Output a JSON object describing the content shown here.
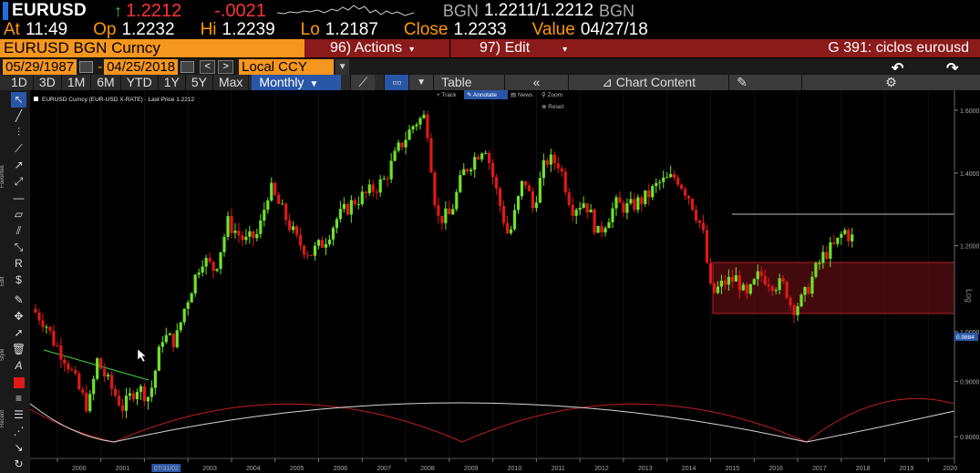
{
  "ticker": {
    "symbol": "EURUSD",
    "arrow": "↑",
    "last": "1.2212",
    "change": "-.0021",
    "source_label": "BGN",
    "bid_ask": "1.2211/1.2212",
    "source_label2": "BGN"
  },
  "stats": {
    "at_label": "At",
    "at": "11:49",
    "op_label": "Op",
    "op": "1.2232",
    "hi_label": "Hi",
    "hi": "1.2239",
    "lo_label": "Lo",
    "lo": "1.2187",
    "close_label": "Close",
    "close": "1.2233",
    "value_label": "Value",
    "value": "04/27/18"
  },
  "titlebar": {
    "security": "EURUSD BGN Curncy",
    "actions": "96) Actions",
    "edit": "97) Edit",
    "chart_name": "G 391: ciclos eurousd"
  },
  "dates": {
    "start": "05/29/1987",
    "end": "04/25/2018",
    "currency": "Local CCY"
  },
  "periods": [
    "1D",
    "3D",
    "1M",
    "6M",
    "YTD",
    "1Y",
    "5Y",
    "Max"
  ],
  "frequency": "Monthly",
  "toolbar": {
    "table": "Table",
    "chart_content": "Chart Content"
  },
  "subtools": {
    "track": "Track",
    "annotate": "Annotate",
    "news": "News",
    "zoom": "Zoom",
    "reset": "Reset"
  },
  "side_labels": {
    "favorites": "Favorites",
    "edit": "Edit",
    "style": "Style",
    "more": "Recent"
  },
  "colors": {
    "up": "#6fe22a",
    "down": "#e01818",
    "accent": "#f5961e",
    "red_bar": "#8b1a1a",
    "blue": "#2a56a8"
  },
  "chart_data": {
    "type": "candlestick",
    "legend": "EURUSD Curncy (EUR-USD X-RATE) · Last Price 1.2212",
    "y_scale": "log",
    "ylim": [
      0.77,
      1.65
    ],
    "y_ticks": [
      "1.6000",
      "1.4000",
      "1.2000",
      "1.0000",
      "0.9000",
      "0.8000"
    ],
    "last_marker": "0.9884",
    "axis_label": "Log",
    "x_ticks": [
      "2000",
      "2001",
      "07/31/02",
      "2003",
      "2004",
      "2005",
      "2006",
      "2007",
      "2008",
      "2009",
      "2010",
      "2011",
      "2012",
      "2013",
      "2014",
      "2015",
      "2016",
      "2017",
      "2018",
      "2019",
      "2020"
    ],
    "x_start": 1999.5,
    "x_end": 2020.6,
    "series": [
      {
        "x": 1999.5,
        "y": 1.05
      },
      {
        "x": 1999.8,
        "y": 1.02
      },
      {
        "x": 2000.0,
        "y": 0.98
      },
      {
        "x": 2000.3,
        "y": 0.94
      },
      {
        "x": 2000.6,
        "y": 0.88
      },
      {
        "x": 2000.8,
        "y": 0.85
      },
      {
        "x": 2001.0,
        "y": 0.94
      },
      {
        "x": 2001.3,
        "y": 0.89
      },
      {
        "x": 2001.6,
        "y": 0.85
      },
      {
        "x": 2001.9,
        "y": 0.89
      },
      {
        "x": 2002.2,
        "y": 0.87
      },
      {
        "x": 2002.5,
        "y": 0.99
      },
      {
        "x": 2002.8,
        "y": 0.98
      },
      {
        "x": 2003.0,
        "y": 1.05
      },
      {
        "x": 2003.4,
        "y": 1.17
      },
      {
        "x": 2003.7,
        "y": 1.14
      },
      {
        "x": 2004.0,
        "y": 1.26
      },
      {
        "x": 2004.4,
        "y": 1.21
      },
      {
        "x": 2004.7,
        "y": 1.23
      },
      {
        "x": 2004.95,
        "y": 1.36
      },
      {
        "x": 2005.3,
        "y": 1.28
      },
      {
        "x": 2005.6,
        "y": 1.21
      },
      {
        "x": 2005.9,
        "y": 1.18
      },
      {
        "x": 2006.2,
        "y": 1.21
      },
      {
        "x": 2006.5,
        "y": 1.27
      },
      {
        "x": 2006.9,
        "y": 1.32
      },
      {
        "x": 2007.2,
        "y": 1.34
      },
      {
        "x": 2007.6,
        "y": 1.38
      },
      {
        "x": 2007.9,
        "y": 1.47
      },
      {
        "x": 2008.3,
        "y": 1.56
      },
      {
        "x": 2008.55,
        "y": 1.58
      },
      {
        "x": 2008.8,
        "y": 1.27
      },
      {
        "x": 2009.1,
        "y": 1.28
      },
      {
        "x": 2009.4,
        "y": 1.4
      },
      {
        "x": 2009.9,
        "y": 1.49
      },
      {
        "x": 2010.2,
        "y": 1.33
      },
      {
        "x": 2010.45,
        "y": 1.22
      },
      {
        "x": 2010.8,
        "y": 1.39
      },
      {
        "x": 2011.0,
        "y": 1.3
      },
      {
        "x": 2011.3,
        "y": 1.44
      },
      {
        "x": 2011.6,
        "y": 1.43
      },
      {
        "x": 2011.9,
        "y": 1.3
      },
      {
        "x": 2012.2,
        "y": 1.32
      },
      {
        "x": 2012.5,
        "y": 1.23
      },
      {
        "x": 2012.9,
        "y": 1.31
      },
      {
        "x": 2013.2,
        "y": 1.3
      },
      {
        "x": 2013.6,
        "y": 1.33
      },
      {
        "x": 2013.9,
        "y": 1.37
      },
      {
        "x": 2014.3,
        "y": 1.39
      },
      {
        "x": 2014.6,
        "y": 1.33
      },
      {
        "x": 2014.9,
        "y": 1.24
      },
      {
        "x": 2015.1,
        "y": 1.08
      },
      {
        "x": 2015.4,
        "y": 1.11
      },
      {
        "x": 2015.7,
        "y": 1.12
      },
      {
        "x": 2015.9,
        "y": 1.07
      },
      {
        "x": 2016.2,
        "y": 1.13
      },
      {
        "x": 2016.5,
        "y": 1.11
      },
      {
        "x": 2016.8,
        "y": 1.1
      },
      {
        "x": 2016.95,
        "y": 1.05
      },
      {
        "x": 2017.2,
        "y": 1.07
      },
      {
        "x": 2017.5,
        "y": 1.14
      },
      {
        "x": 2017.7,
        "y": 1.18
      },
      {
        "x": 2017.95,
        "y": 1.2
      },
      {
        "x": 2018.15,
        "y": 1.24
      },
      {
        "x": 2018.3,
        "y": 1.22
      }
    ]
  }
}
